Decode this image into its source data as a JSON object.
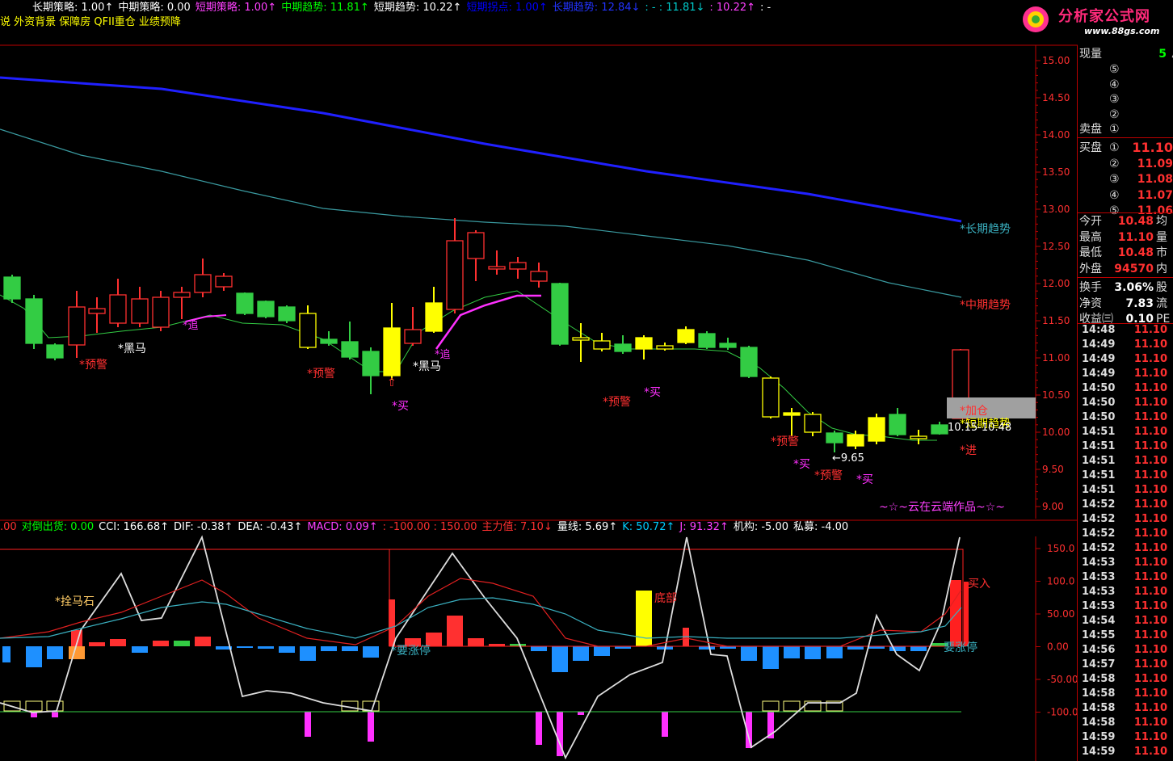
{
  "header": {
    "line1": [
      {
        "label": "长期策略: 1.00↑",
        "color": "#ffffff"
      },
      {
        "label": "中期策略: 0.00",
        "color": "#ffffff"
      },
      {
        "label": "短期策略: 1.00↑",
        "color": "#ff40ff"
      },
      {
        "label": "中期趋势: 11.81↑",
        "color": "#00ff00"
      },
      {
        "label": "短期趋势: 10.22↑",
        "color": "#ffffff"
      },
      {
        "label": "短期拐点: 1.00↑",
        "color": "#0000ff"
      },
      {
        "label": "长期趋势: 12.84↓",
        "color": "#2233ff"
      },
      {
        "label": ": - : 11.81↓",
        "color": "#00cccc"
      },
      {
        "label": ": 10.22↑",
        "color": "#ff40ff"
      },
      {
        "label": ": -",
        "color": "#ffffff"
      }
    ],
    "line2": "说 外资背景 保障房 QFII重仓 业绩预降",
    "line2_color": "#ffff00"
  },
  "logo": {
    "text": "分析家公式网",
    "url": "www.88gs.com"
  },
  "price_axis": {
    "labels": [
      "15.00",
      "14.50",
      "14.00",
      "13.50",
      "13.00",
      "12.50",
      "12.00",
      "11.50",
      "11.00",
      "10.50",
      "10.00",
      "9.50",
      "9.00"
    ]
  },
  "indicator_axis": {
    "labels": [
      "150.0",
      "100.0",
      "50.00",
      "0.00",
      "-50.00",
      "-100.0"
    ]
  },
  "indicator_header": [
    {
      "label": ".00",
      "color": "#ff3030"
    },
    {
      "label": "对倒出货: 0.00",
      "color": "#00ff00"
    },
    {
      "label": "CCI: 166.68↑",
      "color": "#ffffff"
    },
    {
      "label": "DIF: -0.38↑",
      "color": "#ffffff"
    },
    {
      "label": "DEA: -0.43↑",
      "color": "#ffffff"
    },
    {
      "label": "MACD: 0.09↑",
      "color": "#ff40ff"
    },
    {
      "label": ": -100.00 : 150.00",
      "color": "#ff3030"
    },
    {
      "label": "主力值: 7.10↓",
      "color": "#ff3030"
    },
    {
      "label": "量线: 5.69↑",
      "color": "#ffffff"
    },
    {
      "label": "K: 50.72↑",
      "color": "#00ccff"
    },
    {
      "label": "J: 91.32↑",
      "color": "#ff40ff"
    },
    {
      "label": "机构: -5.00",
      "color": "#ffffff"
    },
    {
      "label": "私募: -4.00",
      "color": "#ffffff"
    }
  ],
  "annotations": {
    "long_trend": "*长期趋势",
    "mid_trend": "*中期趋势",
    "short_trend": "*短期趋势",
    "warning": "*预警",
    "buy": "*买",
    "dark_horse": "*黑马",
    "chase": "*追",
    "add": "*加仓",
    "enter": "*进",
    "low_price": "←9.65",
    "last_price": "10.15-10.48",
    "signature": "~☆~云在云端作品~☆~",
    "shuan": "*拴马石",
    "limit_up": "*要涨停",
    "limit_up2": "要涨停",
    "bottom": "底部",
    "buy_in": "买入"
  },
  "side_panel": {
    "now_vol_label": "现量",
    "now_vol": "5",
    "total_label": "总",
    "sell_label": "卖盘",
    "buy_label": "买盘",
    "levels": [
      "⑤",
      "④",
      "③",
      "②",
      "①"
    ],
    "buy_levels": [
      {
        "n": "①",
        "p": "11.10"
      },
      {
        "n": "②",
        "p": "11.09"
      },
      {
        "n": "③",
        "p": "11.08"
      },
      {
        "n": "④",
        "p": "11.07"
      },
      {
        "n": "⑤",
        "p": "11.06"
      }
    ],
    "stats": [
      {
        "k": "今开",
        "v": "10.48",
        "x": "均",
        "c": "#ff3030"
      },
      {
        "k": "最高",
        "v": "11.10",
        "x": "量",
        "c": "#ff3030"
      },
      {
        "k": "最低",
        "v": "10.48",
        "x": "市",
        "c": "#ff3030"
      },
      {
        "k": "外盘",
        "v": "94570",
        "x": "内",
        "c": "#ff3030"
      },
      {
        "k": "换手",
        "v": "3.06%",
        "x": "股",
        "c": "#ffffff"
      },
      {
        "k": "净资",
        "v": "7.83",
        "x": "流",
        "c": "#ffffff"
      },
      {
        "k": "收益㈢",
        "v": "0.10",
        "x": "PE",
        "c": "#ffffff"
      }
    ],
    "ticks": [
      {
        "t": "14:48",
        "p": "11.10"
      },
      {
        "t": "14:49",
        "p": "11.10"
      },
      {
        "t": "14:49",
        "p": "11.10"
      },
      {
        "t": "14:49",
        "p": "11.10"
      },
      {
        "t": "14:50",
        "p": "11.10"
      },
      {
        "t": "14:50",
        "p": "11.10"
      },
      {
        "t": "14:50",
        "p": "11.10"
      },
      {
        "t": "14:51",
        "p": "11.10"
      },
      {
        "t": "14:51",
        "p": "11.10"
      },
      {
        "t": "14:51",
        "p": "11.10"
      },
      {
        "t": "14:51",
        "p": "11.10"
      },
      {
        "t": "14:51",
        "p": "11.10"
      },
      {
        "t": "14:52",
        "p": "11.10"
      },
      {
        "t": "14:52",
        "p": "11.10"
      },
      {
        "t": "14:52",
        "p": "11.10"
      },
      {
        "t": "14:52",
        "p": "11.10"
      },
      {
        "t": "14:53",
        "p": "11.10"
      },
      {
        "t": "14:53",
        "p": "11.10"
      },
      {
        "t": "14:53",
        "p": "11.10"
      },
      {
        "t": "14:53",
        "p": "11.10"
      },
      {
        "t": "14:54",
        "p": "11.10"
      },
      {
        "t": "14:55",
        "p": "11.10"
      },
      {
        "t": "14:56",
        "p": "11.10"
      },
      {
        "t": "14:57",
        "p": "11.10"
      },
      {
        "t": "14:58",
        "p": "11.10"
      },
      {
        "t": "14:58",
        "p": "11.10"
      },
      {
        "t": "14:58",
        "p": "11.10"
      },
      {
        "t": "14:58",
        "p": "11.10"
      },
      {
        "t": "14:59",
        "p": "11.10"
      },
      {
        "t": "14:59",
        "p": "11.10"
      }
    ]
  },
  "colors": {
    "up": "#ff3030",
    "down": "#33cc44",
    "doji": "#ffff00",
    "long_line": "#2020ff",
    "mid_line": "#3a9aa0",
    "short_line": "#33cc44",
    "chase_line": "#ff30ff"
  }
}
